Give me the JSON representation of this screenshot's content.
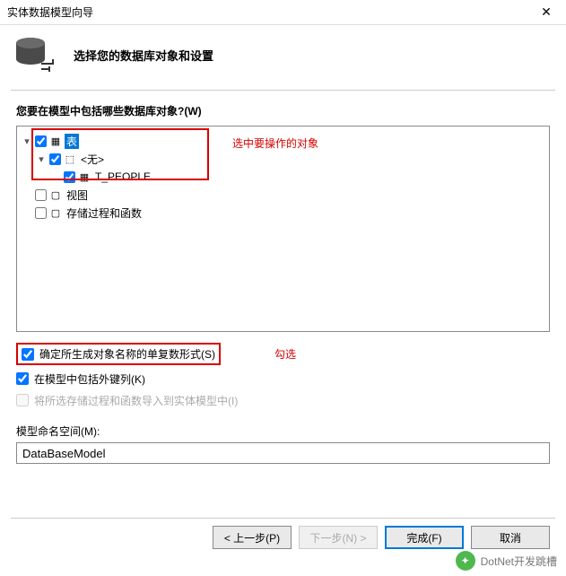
{
  "window": {
    "title": "实体数据模型向导",
    "close_glyph": "✕"
  },
  "header": {
    "subtitle": "选择您的数据库对象和设置"
  },
  "question": "您要在模型中包括哪些数据库对象?(W)",
  "tree": {
    "tables": {
      "label": "表",
      "expanded": true,
      "checked": true
    },
    "none_schema": {
      "label": "<无>",
      "checked": true
    },
    "t_people": {
      "label": "T_PEOPLE",
      "checked": true
    },
    "views": {
      "label": "视图",
      "checked": false
    },
    "procs": {
      "label": "存储过程和函数",
      "checked": false
    }
  },
  "annotations": {
    "select_target": "选中要操作的对象",
    "check_option": "勾选"
  },
  "options": {
    "pluralize": {
      "label": "确定所生成对象名称的单复数形式(S)",
      "checked": true
    },
    "foreign_keys": {
      "label": "在模型中包括外键列(K)",
      "checked": true
    },
    "import_procs": {
      "label": "将所选存储过程和函数导入到实体模型中(I)",
      "checked": false
    }
  },
  "namespace": {
    "label": "模型命名空间(M):",
    "value": "DataBaseModel"
  },
  "buttons": {
    "prev": "< 上一步(P)",
    "next": "下一步(N) >",
    "finish": "完成(F)",
    "cancel": "取消"
  },
  "watermark": {
    "text": "DotNet开发跳槽"
  }
}
